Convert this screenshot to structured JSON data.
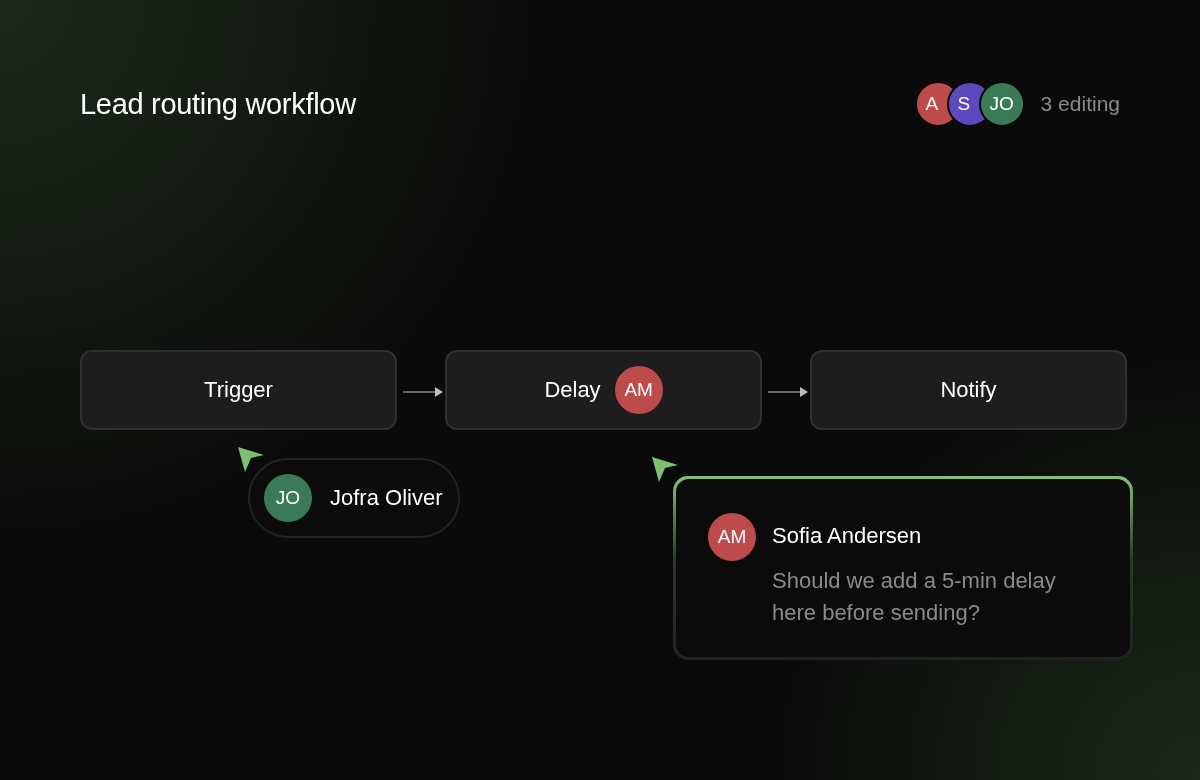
{
  "title": "Lead routing workflow",
  "collaborators": {
    "avatars": [
      {
        "initials": "A",
        "color": "#bd4b4b"
      },
      {
        "initials": "S",
        "color": "#5b49bd"
      },
      {
        "initials": "JO",
        "color": "#3b7a57"
      }
    ],
    "label": "3 editing"
  },
  "nodes": [
    {
      "label": "Trigger"
    },
    {
      "label": "Delay",
      "avatar": {
        "initials": "AM",
        "color": "#bd4b4b"
      }
    },
    {
      "label": "Notify"
    }
  ],
  "cursors": [
    {
      "kind": "presence",
      "initials": "JO",
      "color": "#3b7a57",
      "name": "Jofra Oliver"
    },
    {
      "kind": "comment",
      "initials": "AM",
      "color": "#bd4b4b",
      "name": "Sofia Andersen",
      "message": "Should we add a 5-min delay here before sending?"
    }
  ]
}
